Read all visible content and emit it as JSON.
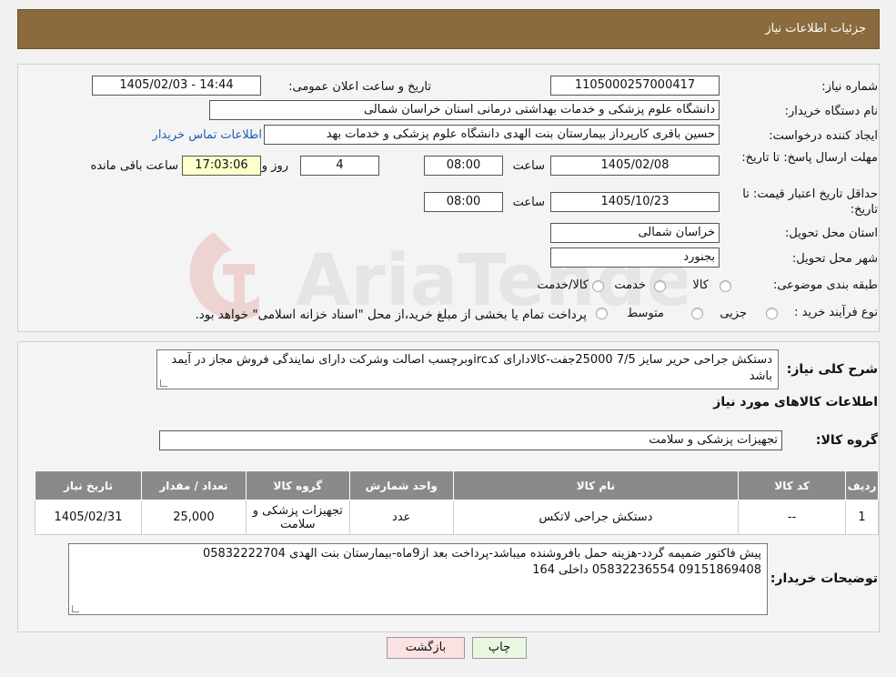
{
  "header": {
    "title": "جزئیات اطلاعات نیاز"
  },
  "form": {
    "need_number_label": "شماره نیاز:",
    "need_number": "1105000257000417",
    "announce_label": "تاریخ و ساعت اعلان عمومی:",
    "announce_value": "1405/02/03 - 14:44",
    "buyer_org_label": "نام دستگاه خریدار:",
    "buyer_org": "دانشگاه علوم پزشکی و خدمات بهداشتی درمانی استان خراسان شمالی",
    "requester_label": "ایجاد کننده درخواست:",
    "requester": "حسین باقری کارپرداز بیمارستان بنت الهدی دانشگاه علوم پزشکی و خدمات بهد",
    "contact_link": "اطلاعات تماس خریدار",
    "deadline_label": "مهلت ارسال پاسخ: تا تاریخ:",
    "deadline_date": "1405/02/08",
    "time_label": "ساعت",
    "deadline_time": "08:00",
    "days_value": "4",
    "days_label": "روز و",
    "remaining_time": "17:03:06",
    "remaining_label": "ساعت باقی مانده",
    "validity_label": "حداقل تاریخ اعتبار قیمت: تا تاریخ:",
    "validity_date": "1405/10/23",
    "validity_time": "08:00",
    "province_label": "استان محل تحویل:",
    "province": "خراسان شمالی",
    "city_label": "شهر محل تحویل:",
    "city": "بجنورد",
    "category_label": "طبقه بندی موضوعی:",
    "category_options": [
      "کالا",
      "خدمت",
      "کالا/خدمت"
    ],
    "process_label": "نوع فرآیند خرید :",
    "process_options": [
      "جزیی",
      "متوسط"
    ],
    "process_note": "پرداخت تمام یا بخشی از مبلغ خرید،از محل \"اسناد خزانه اسلامی\" خواهد بود."
  },
  "description": {
    "label": "شرح کلی نیاز:",
    "text": "دستکش جراحی حریر سایز 7/5 25000جفت-کالادارای کدircوبرچسب اصالت وشرکت دارای نمایندگی فروش مجاز در آیمد باشد"
  },
  "goods": {
    "section_title": "اطلاعات کالاهای مورد نیاز",
    "group_label": "گروه کالا:",
    "group_value": "تجهیزات پزشکی و سلامت",
    "columns": [
      "ردیف",
      "کد کالا",
      "نام کالا",
      "واحد شمارش",
      "گروه کالا",
      "تعداد / مقدار",
      "تاریخ نیاز"
    ],
    "rows": [
      [
        "1",
        "--",
        "دستکش جراحی لاتکس",
        "عدد",
        "تجهیزات پزشکی و سلامت",
        "25,000",
        "1405/02/31"
      ]
    ]
  },
  "buyer_notes": {
    "label": "توضیحات خریدار:",
    "line1": "پیش فاکتور ضمیمه گردد-هزینه حمل بافروشنده میباشد-پرداخت بعد از9ماه-بیمارستان بنت الهدی 05832222704",
    "line2": "09151869408 05832236554  داخلی 164"
  },
  "buttons": {
    "print": "چاپ",
    "back": "بازگشت"
  }
}
